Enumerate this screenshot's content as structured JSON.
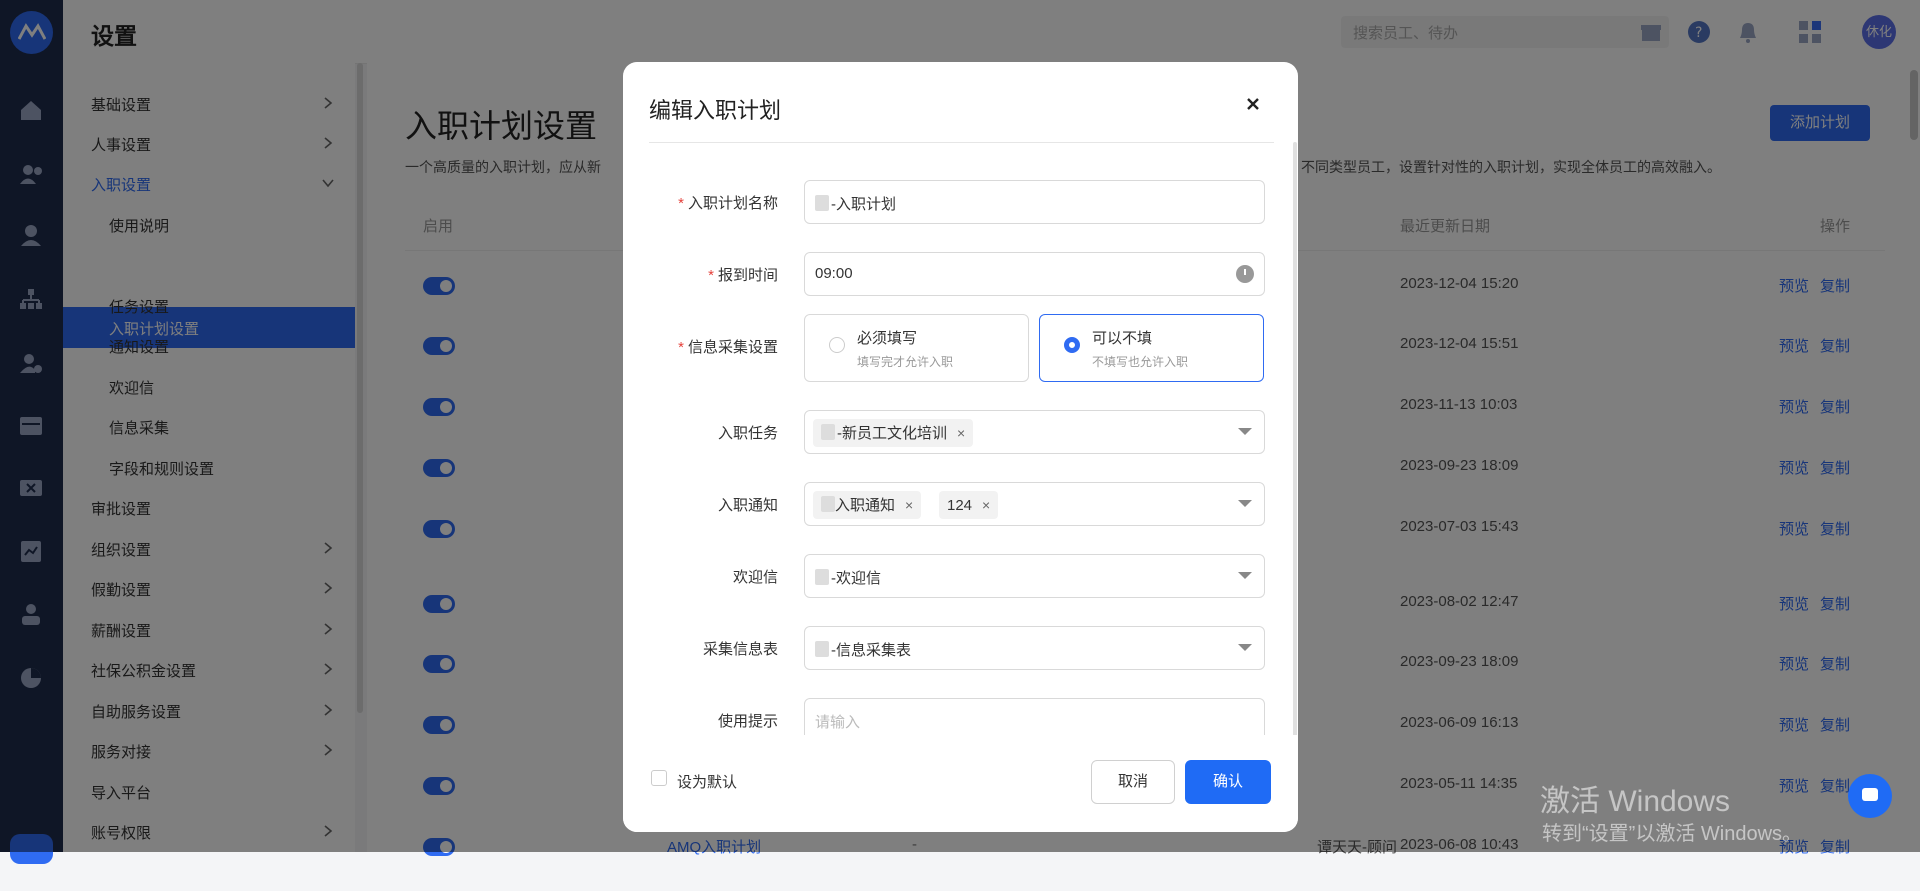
{
  "topbar": {
    "title": "设置",
    "search_placeholder": "搜索员工、待办",
    "avatar": "休化"
  },
  "menu": {
    "items": [
      {
        "label": "基础设置"
      },
      {
        "label": "人事设置"
      },
      {
        "label": "入职设置"
      },
      {
        "label": "使用说明"
      },
      {
        "label": "入职计划设置"
      },
      {
        "label": "任务设置"
      },
      {
        "label": "通知设置"
      },
      {
        "label": "欢迎信"
      },
      {
        "label": "信息采集"
      },
      {
        "label": "字段和规则设置"
      },
      {
        "label": "审批设置"
      },
      {
        "label": "组织设置"
      },
      {
        "label": "假勤设置"
      },
      {
        "label": "薪酬设置"
      },
      {
        "label": "社保公积金设置"
      },
      {
        "label": "自助服务设置"
      },
      {
        "label": "服务对接"
      },
      {
        "label": "导入平台"
      },
      {
        "label": "账号权限"
      }
    ]
  },
  "main": {
    "title": "入职计划设置",
    "desc_left": "一个高质量的入职计划，应从新",
    "desc_right": "不同类型员工，设置针对性的入职计划，实现全体员工的高效融入。",
    "add_button": "添加计划",
    "col_enable": "启用",
    "col_updated": "最近更新日期",
    "col_actions": "操作",
    "rows": [
      {
        "date": "2023-12-04 15:20",
        "preview": "预览",
        "copy": "复制"
      },
      {
        "date": "2023-12-04 15:51",
        "preview": "预览",
        "copy": "复制"
      },
      {
        "date": "2023-11-13 10:03",
        "preview": "预览",
        "copy": "复制"
      },
      {
        "date": "2023-09-23 18:09",
        "preview": "预览",
        "copy": "复制"
      },
      {
        "date": "2023-07-03 15:43",
        "preview": "预览",
        "copy": "复制"
      },
      {
        "date": "2023-08-02 12:47",
        "preview": "预览",
        "copy": "复制"
      },
      {
        "date": "2023-09-23 18:09",
        "preview": "预览",
        "copy": "复制"
      },
      {
        "date": "2023-06-09 16:13",
        "preview": "预览",
        "copy": "复制"
      },
      {
        "date": "2023-05-11 14:35",
        "preview": "预览",
        "copy": "复制"
      },
      {
        "date": "2023-06-08 10:43",
        "preview": "预览",
        "copy": "复制",
        "name": "AMQ入职计划",
        "dash": "-",
        "owner": "谭天天-顾问"
      }
    ]
  },
  "modal": {
    "title": "编辑入职计划",
    "close": "×",
    "plan_name_label": "入职计划名称",
    "plan_name_value": "-入职计划",
    "report_time_label": "报到时间",
    "report_time_value": "09:00",
    "info_label": "信息采集设置",
    "opt_required_title": "必须填写",
    "opt_required_sub": "填写完才允许入职",
    "opt_optional_title": "可以不填",
    "opt_optional_sub": "不填写也允许入职",
    "task_label": "入职任务",
    "task_tag": "-新员工文化培训",
    "notice_label": "入职通知",
    "notice_tag1": "入职通知",
    "notice_tag2": "124",
    "welcome_label": "欢迎信",
    "welcome_value": "-欢迎信",
    "form_label": "采集信息表",
    "form_value": "-信息采集表",
    "tip_label": "使用提示",
    "tip_placeholder": "请输入",
    "required_mark": "*",
    "tag_remove": "×",
    "default_label": "设为默认",
    "cancel": "取消",
    "confirm": "确认"
  },
  "watermark": {
    "line1": "激活 Windows",
    "line2": "转到“设置”以激活 Windows。"
  },
  "colors": {
    "accent": "#2f6bf2",
    "rail": "#1f2d4d",
    "required": "#e5413b"
  }
}
